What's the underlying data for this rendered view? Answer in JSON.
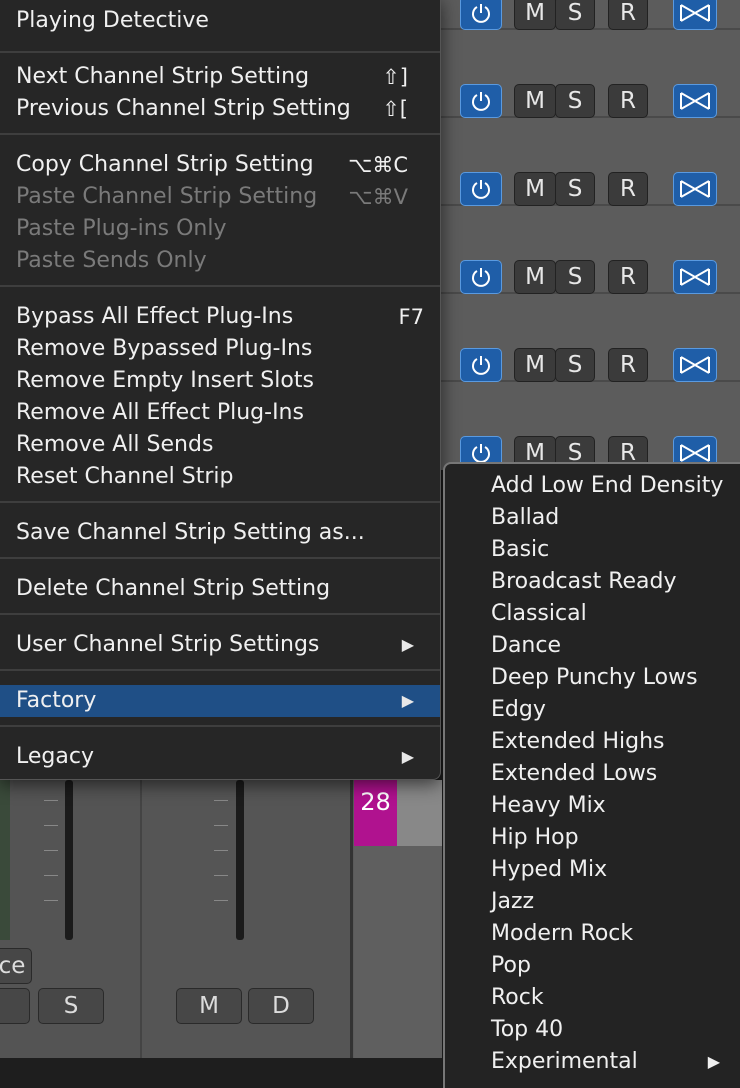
{
  "track_rows": [
    {
      "mute": "M",
      "solo": "S",
      "record": "R"
    },
    {
      "mute": "M",
      "solo": "S",
      "record": "R"
    },
    {
      "mute": "M",
      "solo": "S",
      "record": "R"
    },
    {
      "mute": "M",
      "solo": "S",
      "record": "R"
    },
    {
      "mute": "M",
      "solo": "S",
      "record": "R"
    },
    {
      "mute": "M",
      "solo": "S",
      "record": "R"
    }
  ],
  "lower_mixer": {
    "partial_button": "ce",
    "strip1_solo": "S",
    "strip2_mute": "M",
    "strip2_d": "D",
    "track_number": "28",
    "track_color": "#b0128f"
  },
  "menu": {
    "header": "Playing Detective",
    "items": {
      "next": {
        "label": "Next Channel Strip Setting",
        "shortcut": "⇧]"
      },
      "prev": {
        "label": "Previous Channel Strip Setting",
        "shortcut": "⇧["
      },
      "copy": {
        "label": "Copy Channel Strip Setting",
        "shortcut": "⌥⌘C"
      },
      "paste": {
        "label": "Paste Channel Strip Setting",
        "shortcut": "⌥⌘V"
      },
      "paste_plugins": {
        "label": "Paste Plug-ins Only"
      },
      "paste_sends": {
        "label": "Paste Sends Only"
      },
      "bypass_all": {
        "label": "Bypass All Effect Plug-Ins",
        "shortcut": "F7"
      },
      "remove_bypassed": {
        "label": "Remove Bypassed Plug-Ins"
      },
      "remove_empty": {
        "label": "Remove Empty Insert Slots"
      },
      "remove_all_fx": {
        "label": "Remove All Effect Plug-Ins"
      },
      "remove_sends": {
        "label": "Remove All Sends"
      },
      "reset": {
        "label": "Reset Channel Strip"
      },
      "save_as": {
        "label": "Save Channel Strip Setting as..."
      },
      "delete": {
        "label": "Delete Channel Strip Setting"
      },
      "user": {
        "label": "User Channel Strip Settings"
      },
      "factory": {
        "label": "Factory"
      },
      "legacy": {
        "label": "Legacy"
      }
    }
  },
  "submenu": {
    "items": [
      "Add Low End Density",
      "Ballad",
      "Basic",
      "Broadcast Ready",
      "Classical",
      "Dance",
      "Deep Punchy Lows",
      "Edgy",
      "Extended Highs",
      "Extended Lows",
      "Heavy Mix",
      "Hip Hop",
      "Hyped Mix",
      "Jazz",
      "Modern Rock",
      "Pop",
      "Rock",
      "Top 40",
      "Experimental"
    ]
  },
  "colors": {
    "menu_bg": "#262626",
    "selection": "#1f4f86",
    "power_blue": "#1f5ea8"
  }
}
